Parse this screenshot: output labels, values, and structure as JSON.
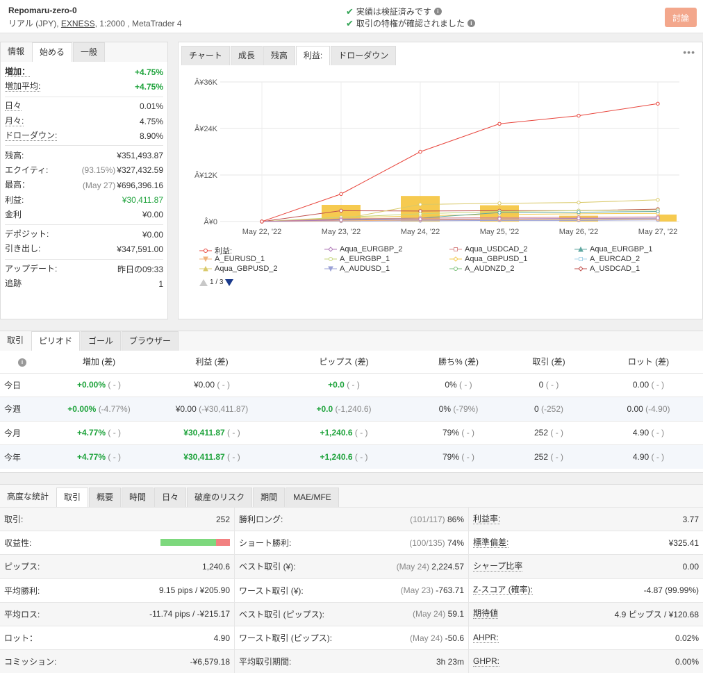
{
  "header": {
    "account_name": "Repomaru-zero-0",
    "account_type": "リアル (JPY), ",
    "broker": "EXNESS",
    "account_meta": ", 1:2000 , MetaTrader 4",
    "verify_1": "実績は検証済みです",
    "verify_2": "取引の特権が確認されました",
    "discuss_label": "討論"
  },
  "info_panel": {
    "tabs": [
      "情報",
      "始める",
      "一般"
    ],
    "rows": [
      {
        "label": "増加：",
        "value": "+4.75%"
      },
      {
        "label": "増加平均:",
        "value": "+4.75%"
      },
      {
        "label": "日々",
        "value": "0.01%"
      },
      {
        "label": "月々:",
        "value": "4.75%"
      },
      {
        "label": "ドローダウン:",
        "value": "8.90%"
      },
      {
        "label": "残高:",
        "value": "¥351,493.87"
      },
      {
        "label": "エクイティ:",
        "sub": "(93.15%)",
        "value": "¥327,432.59"
      },
      {
        "label": "最高：",
        "sub": "(May 27)",
        "value": "¥696,396.16"
      },
      {
        "label": "利益:",
        "value": "¥30,411.87"
      },
      {
        "label": "金利",
        "value": "¥0.00"
      },
      {
        "label": "デポジット:",
        "value": "¥0.00"
      },
      {
        "label": "引き出し:",
        "value": "¥347,591.00"
      },
      {
        "label": "アップデート:",
        "value": "昨日の09:33"
      },
      {
        "label": "追跡",
        "value": "1"
      }
    ]
  },
  "chart_panel": {
    "tabs": [
      "チャート",
      "成長",
      "残高",
      "利益:",
      "ドローダウン"
    ],
    "more": "•••",
    "pager": "1 / 3"
  },
  "chart_data": {
    "type": "line",
    "x": [
      "May 22, '22",
      "May 23, '22",
      "May 24, '22",
      "May 25, '22",
      "May 26, '22",
      "May 27, '22"
    ],
    "y_ticks": [
      "Â¥0",
      "Â¥12K",
      "Â¥24K",
      "Â¥36K"
    ],
    "ylim": [
      0,
      36000
    ],
    "bars": [
      0,
      4300,
      6600,
      4200,
      1500,
      1800
    ],
    "series": [
      {
        "name": "利益:",
        "color": "#e8453c",
        "values": [
          0,
          7100,
          18000,
          25200,
          27300,
          30400
        ]
      },
      {
        "name": "Aqua_EURGBP_2",
        "color": "#b07ab8",
        "values": [
          0,
          400,
          600,
          700,
          800,
          900
        ]
      },
      {
        "name": "Aqua_USDCAD_2",
        "color": "#d98c8c",
        "values": [
          0,
          700,
          900,
          1000,
          1100,
          1200
        ]
      },
      {
        "name": "Aqua_EURGBP_1",
        "color": "#5fa7a0",
        "values": [
          0,
          500,
          900,
          2300,
          2400,
          2600
        ]
      },
      {
        "name": "A_EURUSD_1",
        "color": "#f0b27a",
        "values": [
          0,
          200,
          400,
          500,
          500,
          600
        ]
      },
      {
        "name": "A_EURGBP_1",
        "color": "#c5d57a",
        "values": [
          0,
          1100,
          2000,
          2600,
          2800,
          3000
        ]
      },
      {
        "name": "Aqua_GBPUSD_1",
        "color": "#f2c94c",
        "values": [
          0,
          900,
          1500,
          1800,
          2000,
          2100
        ]
      },
      {
        "name": "A_EURCAD_2",
        "color": "#a9d4e8",
        "values": [
          0,
          300,
          500,
          600,
          700,
          800
        ]
      },
      {
        "name": "Aqua_GBPUSD_2",
        "color": "#d9c96a",
        "values": [
          0,
          600,
          4400,
          4700,
          4900,
          5600
        ]
      },
      {
        "name": "A_AUDUSD_1",
        "color": "#9aa0d6",
        "values": [
          0,
          100,
          200,
          300,
          300,
          400
        ]
      },
      {
        "name": "A_AUDNZD_2",
        "color": "#7cbf7c",
        "values": [
          0,
          300,
          500,
          600,
          700,
          800
        ]
      },
      {
        "name": "A_USDCAD_1",
        "color": "#c0504d",
        "values": [
          0,
          2800,
          2700,
          2800,
          2800,
          3200
        ]
      }
    ]
  },
  "period_panel": {
    "tabs": [
      "取引",
      "ピリオド",
      "ゴール",
      "ブラウザー"
    ],
    "headers": [
      "増加 (差)",
      "利益 (差)",
      "ピップス (差)",
      "勝ち% (差)",
      "取引 (差)",
      "ロット (差)"
    ],
    "rows": [
      {
        "label": "今日",
        "gain": "+0.00%",
        "gain_d": "( - )",
        "profit": "¥0.00",
        "profit_d": "( - )",
        "pips": "+0.0",
        "pips_d": "( - )",
        "win": "0%",
        "win_d": "( - )",
        "trades": "0",
        "trades_d": "( - )",
        "lots": "0.00",
        "lots_d": "( - )"
      },
      {
        "label": "今週",
        "gain": "+0.00%",
        "gain_d": "(-4.77%)",
        "profit": "¥0.00",
        "profit_d": "(-¥30,411.87)",
        "pips": "+0.0",
        "pips_d": "(-1,240.6)",
        "win": "0%",
        "win_d": "(-79%)",
        "trades": "0",
        "trades_d": "(-252)",
        "lots": "0.00",
        "lots_d": "(-4.90)"
      },
      {
        "label": "今月",
        "gain": "+4.77%",
        "gain_d": "( - )",
        "profit": "¥30,411.87",
        "profit_d": "( - )",
        "pips": "+1,240.6",
        "pips_d": "( - )",
        "win": "79%",
        "win_d": "( - )",
        "trades": "252",
        "trades_d": "( - )",
        "lots": "4.90",
        "lots_d": "( - )"
      },
      {
        "label": "今年",
        "gain": "+4.77%",
        "gain_d": "( - )",
        "profit": "¥30,411.87",
        "profit_d": "( - )",
        "pips": "+1,240.6",
        "pips_d": "( - )",
        "win": "79%",
        "win_d": "( - )",
        "trades": "252",
        "trades_d": "( - )",
        "lots": "4.90",
        "lots_d": "( - )"
      }
    ]
  },
  "stats_panel": {
    "tabs": [
      "高度な統計",
      "取引",
      "概要",
      "時間",
      "日々",
      "破産のリスク",
      "期間",
      "MAE/MFE"
    ],
    "profitability": {
      "win_fraction": 0.8,
      "win_color": "#7dd87d",
      "loss_color": "#f28080"
    },
    "col1": [
      {
        "label": "取引:",
        "value": "252"
      },
      {
        "label": "収益性:",
        "value": ""
      },
      {
        "label": "ピップス:",
        "value": "1,240.6"
      },
      {
        "label": "平均勝利:",
        "value": "9.15 pips / ¥205.90"
      },
      {
        "label": "平均ロス:",
        "value": "-11.74 pips / -¥215.17"
      },
      {
        "label": "ロット：",
        "value": "4.90"
      },
      {
        "label": "コミッション:",
        "value": "-¥6,579.18"
      }
    ],
    "col2": [
      {
        "label": "勝利ロング:",
        "sub": "(101/117)",
        "value": "86%"
      },
      {
        "label": "ショート勝利:",
        "sub": "(100/135)",
        "value": "74%"
      },
      {
        "label": "ベスト取引 (¥):",
        "sub": "(May 24)",
        "value": "2,224.57"
      },
      {
        "label": "ワースト取引 (¥):",
        "sub": "(May 23)",
        "value": "-763.71"
      },
      {
        "label": "ベスト取引 (ピップス):",
        "sub": "(May 24)",
        "value": "59.1"
      },
      {
        "label": "ワースト取引 (ピップス):",
        "sub": "(May 24)",
        "value": "-50.6"
      },
      {
        "label": "平均取引期間:",
        "sub": "",
        "value": "3h 23m"
      }
    ],
    "col3": [
      {
        "label": "利益率:",
        "value": "3.77"
      },
      {
        "label": "標準偏差:",
        "value": "¥325.41"
      },
      {
        "label": "シャープ比率",
        "value": "0.00"
      },
      {
        "label": "Z-スコア (確率):",
        "value": "-4.87 (99.99%)"
      },
      {
        "label": "期待値",
        "value": "4.9 ピップス / ¥120.68"
      },
      {
        "label": "AHPR:",
        "value": "0.02%"
      },
      {
        "label": "GHPR:",
        "value": "0.00%"
      }
    ]
  }
}
